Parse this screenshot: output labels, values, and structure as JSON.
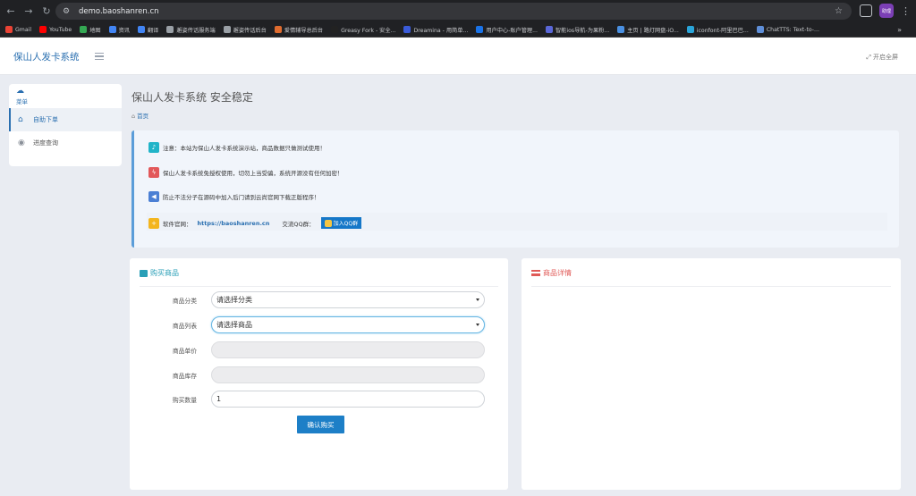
{
  "browser": {
    "url": "demo.baoshanren.cn",
    "profile_label": "助理",
    "bookmarks": [
      {
        "label": "Gmail",
        "color": "#ea4335"
      },
      {
        "label": "YouTube",
        "color": "#ff0000"
      },
      {
        "label": "地图",
        "color": "#34a853"
      },
      {
        "label": "资讯",
        "color": "#4285f4"
      },
      {
        "label": "翻译",
        "color": "#4285f4"
      },
      {
        "label": "邂姿传话服务端",
        "color": "#9aa0a6"
      },
      {
        "label": "邂姿传话后台",
        "color": "#9aa0a6"
      },
      {
        "label": "爱情辅导总后台",
        "color": "#e06c2f"
      },
      {
        "label": "Greasy Fork - 安全...",
        "color": "#222222"
      },
      {
        "label": "Dreamina - 用简单...",
        "color": "#3a5bd9"
      },
      {
        "label": "用户中心-账户管理...",
        "color": "#1a73e8"
      },
      {
        "label": "智能ios导航-为果粉...",
        "color": "#5a67d8"
      },
      {
        "label": "主页 | 路灯网盘-iO...",
        "color": "#4a90e2"
      },
      {
        "label": "iconfont-阿里巴巴...",
        "color": "#2aa5d9"
      },
      {
        "label": "ChatTTS: Text-to-...",
        "color": "#5f8fd9"
      }
    ]
  },
  "header": {
    "brand": "保山人发卡系统",
    "fullscreen_label": "开启全屏"
  },
  "sidebar": {
    "title": "菜单",
    "items": [
      {
        "label": "自助下单",
        "active": true
      },
      {
        "label": "进度查询",
        "active": false
      }
    ]
  },
  "page": {
    "title": "保山人发卡系统 安全稳定",
    "breadcrumb": "首页"
  },
  "notices": {
    "items": [
      {
        "text": "注意：本站为保山人发卡系统演示站，商品数据只做测试使用！",
        "color": "#21b4c8"
      },
      {
        "text": "保山人发卡系统免授权使用，切勿上当受骗，系统开源没有任何加密！",
        "color": "#e2585a"
      },
      {
        "text": "防止不法分子在源码中加入后门请到云尚官网下载正版程序！",
        "color": "#4b7fd4"
      }
    ],
    "website_label": "软件官网：",
    "website_url": "https://baoshanren.cn",
    "qq_group_label": "交流QQ群：",
    "qq_button": "加入QQ群",
    "website_icon_color": "#f3b51e"
  },
  "buy_card": {
    "title": "购买商品",
    "fields": {
      "category_label": "商品分类",
      "category_value": "请选择分类",
      "product_label": "商品列表",
      "product_value": "请选择商品",
      "price_label": "商品单价",
      "price_value": "",
      "stock_label": "商品库存",
      "stock_value": "",
      "quantity_label": "购买数量",
      "quantity_value": "1"
    },
    "submit": "确认购买"
  },
  "detail_card": {
    "title": "商品详情"
  }
}
